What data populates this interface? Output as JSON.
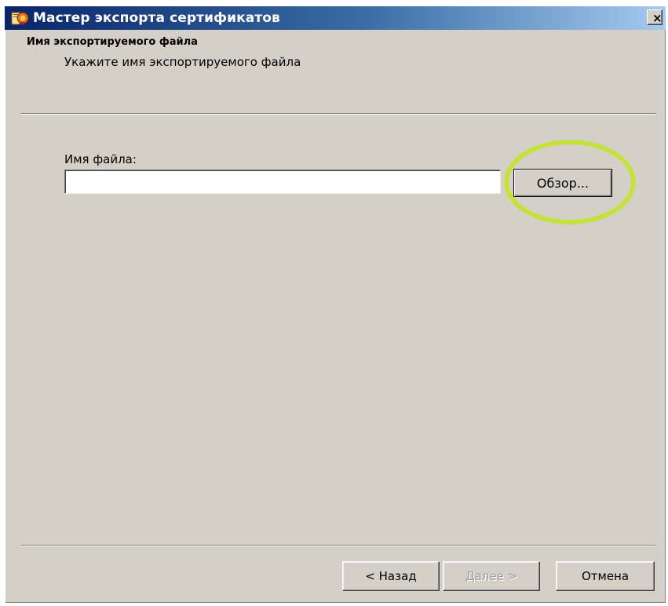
{
  "window": {
    "title": "Мастер экспорта сертификатов",
    "close_glyph": "×"
  },
  "header": {
    "title": "Имя экспортируемого файла",
    "subtitle": "Укажите имя экспортируемого файла"
  },
  "form": {
    "filename_label": "Имя файла:",
    "filename_value": "",
    "browse_label": "Обзор..."
  },
  "footer": {
    "back_label": "< Назад",
    "next_label": "Далее >",
    "cancel_label": "Отмена"
  },
  "icons": {
    "title_icon": "certificate-wizard-icon",
    "close_icon": "close-icon"
  },
  "colors": {
    "title_bar_start": "#0a246a",
    "title_bar_end": "#a6caf0",
    "window_face": "#d4d0c8",
    "highlight_ring": "#c5e23a",
    "disabled_text": "#9a9a9a"
  }
}
